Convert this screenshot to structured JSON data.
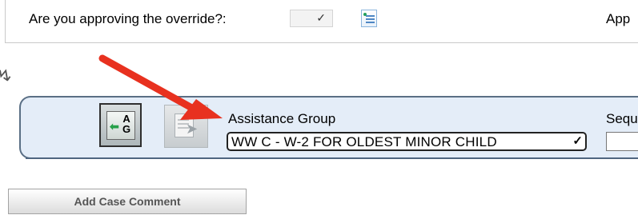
{
  "override": {
    "question_label": "Are you approving the override?:",
    "select_value": "",
    "next_label_partial": "App"
  },
  "assistance_group": {
    "label": "Assistance Group",
    "selected_value": "WW C - W-2 FOR OLDEST MINOR CHILD",
    "nav_button_letters_top": "A",
    "nav_button_letters_bottom": "G"
  },
  "sequence": {
    "label_partial": "Sequ",
    "value": ""
  },
  "actions": {
    "add_case_comment_label": "Add Case Comment"
  },
  "annotation": {
    "color": "#e8311f"
  },
  "icons": {
    "override_select_chevron": "chevron-down-icon",
    "list_picker": "list-icon",
    "ag_nav_arrow": "back-arrow-icon",
    "ag_doc_button": "document-go-icon",
    "ag_select_chevron": "chevron-down-icon"
  },
  "colors": {
    "panel_background": "#e4edf8",
    "panel_border": "#5a6f85",
    "nav_arrow": "#26a04a"
  }
}
